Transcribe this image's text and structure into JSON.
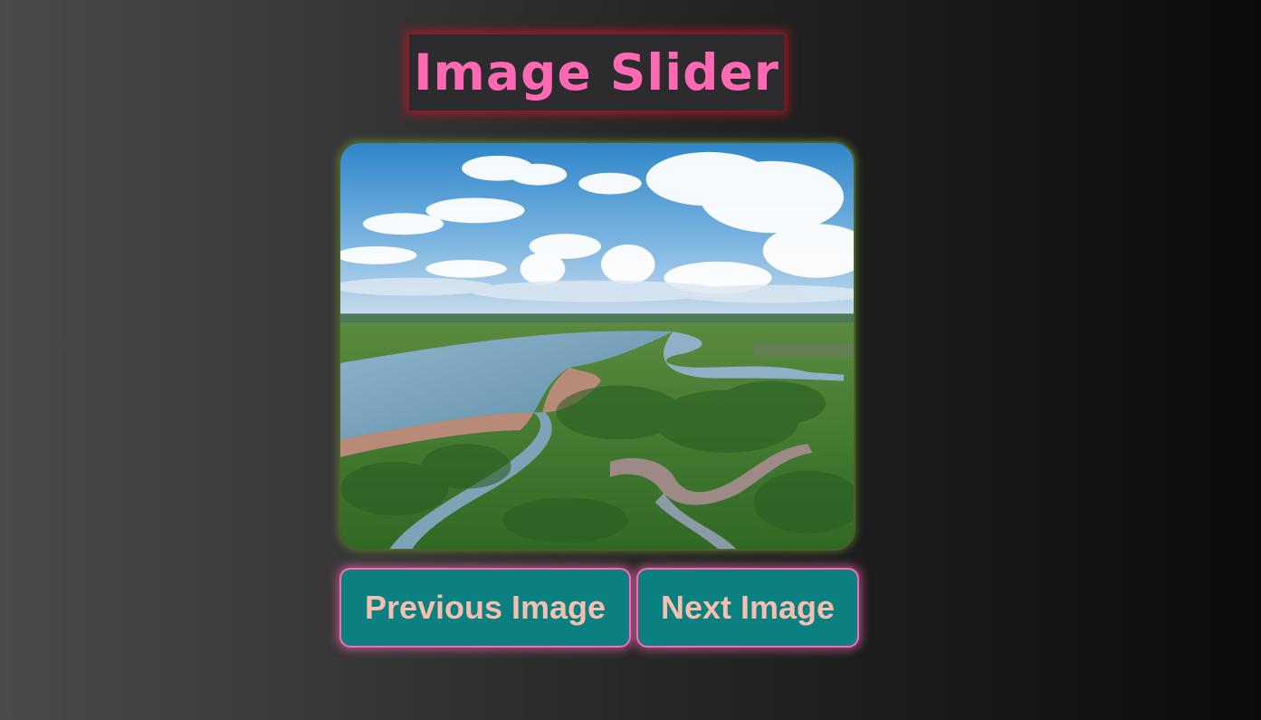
{
  "page": {
    "title": "Image Slider"
  },
  "slider": {
    "image_alt": "Aerial view of a winding river through green mangrove wetlands under a cloudy blue sky"
  },
  "controls": {
    "previous_label": "Previous Image",
    "next_label": "Next Image"
  },
  "colors": {
    "title_text": "#ff69b4",
    "title_glow": "#c81428",
    "button_bg": "#0a8080",
    "button_text": "#f4bfae",
    "button_border": "#ff69b4",
    "image_border": "#4d5f2a"
  }
}
